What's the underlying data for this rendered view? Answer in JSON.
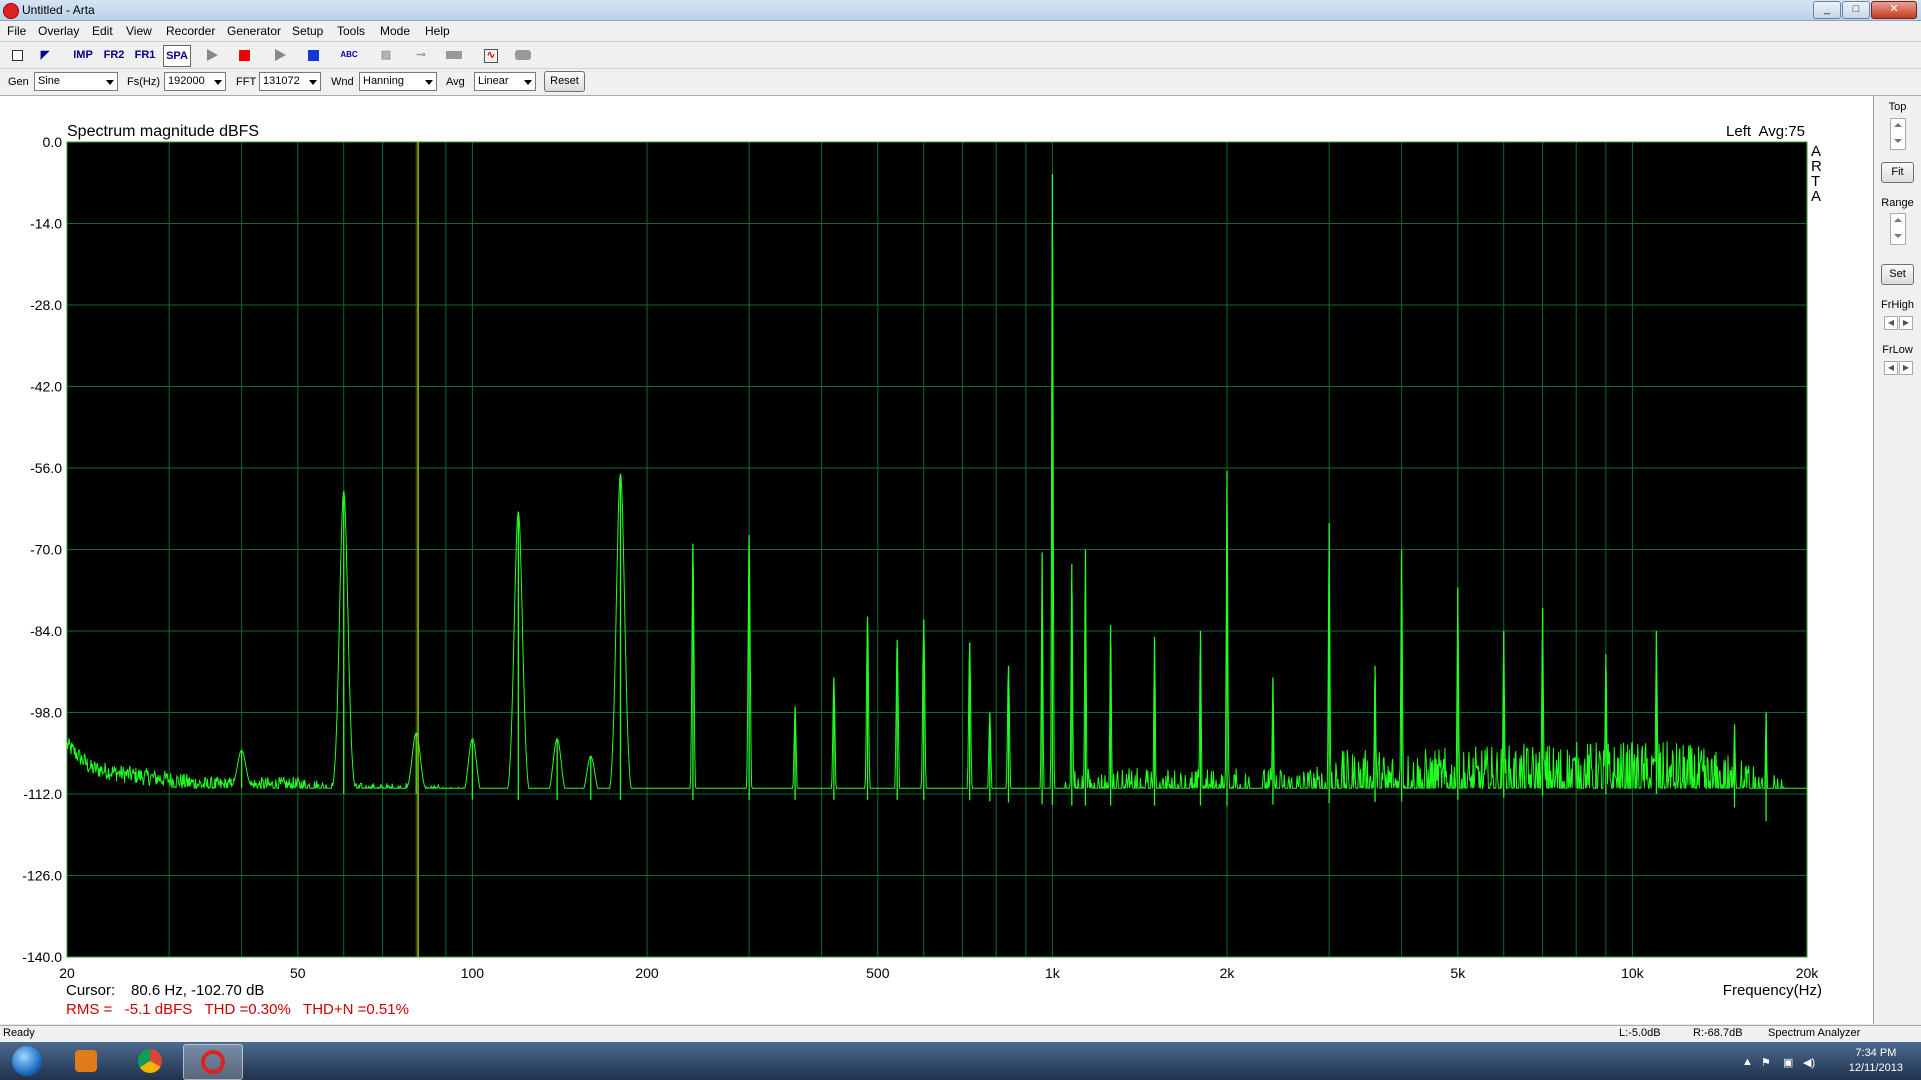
{
  "window": {
    "title": "Untitled - Arta",
    "min": "_",
    "max": "□",
    "close": "✕"
  },
  "menu": [
    "File",
    "Overlay",
    "Edit",
    "View",
    "Recorder",
    "Generator",
    "Setup",
    "Tools",
    "Mode",
    "Help"
  ],
  "toolbar": {
    "imp": "IMP",
    "fr2": "FR2",
    "fr1": "FR1",
    "spa": "SPA",
    "abc": "ABC"
  },
  "controls": {
    "gen_label": "Gen",
    "gen_value": "Sine",
    "fs_label": "Fs(Hz)",
    "fs_value": "192000",
    "fft_label": "FFT",
    "fft_value": "131072",
    "wnd_label": "Wnd",
    "wnd_value": "Hanning",
    "avg_label": "Avg",
    "avg_value": "Linear",
    "reset": "Reset"
  },
  "side": {
    "top": "Top",
    "fit": "Fit",
    "range": "Range",
    "set": "Set",
    "frhigh": "FrHigh",
    "frlow": "FrLow"
  },
  "plot": {
    "title": "Spectrum magnitude dBFS",
    "channel": "Left  Avg:75",
    "brand": [
      "A",
      "R",
      "T",
      "A"
    ],
    "cursor_label": "Cursor:",
    "cursor_value": "80.6 Hz, -102.70 dB",
    "rms": "RMS =   -5.1 dBFS   THD =0.30%   THD+N =0.51%",
    "xlabel": "Frequency(Hz)"
  },
  "chart_data": {
    "type": "line",
    "title": "Spectrum magnitude dBFS",
    "xlabel": "Frequency(Hz)",
    "ylabel": "",
    "x_scale": "log",
    "xlim": [
      20,
      20000
    ],
    "ylim": [
      -140,
      0
    ],
    "y_ticks": [
      "0.0",
      "-14.0",
      "-28.0",
      "-42.0",
      "-56.0",
      "-70.0",
      "-84.0",
      "-98.0",
      "-112.0",
      "-126.0",
      "-140.0"
    ],
    "y_tick_values": [
      0,
      -14,
      -28,
      -42,
      -56,
      -70,
      -84,
      -98,
      -112,
      -126,
      -140
    ],
    "x_ticks": [
      {
        "v": 20,
        "label": "20"
      },
      {
        "v": 50,
        "label": "50"
      },
      {
        "v": 100,
        "label": "100"
      },
      {
        "v": 200,
        "label": "200"
      },
      {
        "v": 500,
        "label": "500"
      },
      {
        "v": 1000,
        "label": "1k"
      },
      {
        "v": 2000,
        "label": "2k"
      },
      {
        "v": 5000,
        "label": "5k"
      },
      {
        "v": 10000,
        "label": "10k"
      },
      {
        "v": 20000,
        "label": "20k"
      }
    ],
    "cursor_x": 80.6,
    "grid": true,
    "noise_floor": [
      [
        20,
        -104
      ],
      [
        22,
        -108
      ],
      [
        25,
        -109
      ],
      [
        30,
        -110
      ],
      [
        35,
        -111
      ],
      [
        40,
        -111
      ],
      [
        50,
        -111
      ],
      [
        60,
        -112
      ],
      [
        80,
        -112
      ],
      [
        100,
        -113
      ],
      [
        200,
        -113
      ],
      [
        400,
        -113
      ],
      [
        700,
        -113
      ],
      [
        1050,
        -114
      ],
      [
        2000,
        -114
      ],
      [
        5000,
        -113
      ],
      [
        8000,
        -112
      ],
      [
        12000,
        -112
      ],
      [
        16000,
        -115
      ],
      [
        18500,
        -119
      ],
      [
        20000,
        -126
      ]
    ],
    "peaks": [
      {
        "f": 40,
        "db": -104.5
      },
      {
        "f": 60,
        "db": -60
      },
      {
        "f": 80,
        "db": -101.5
      },
      {
        "f": 100,
        "db": -102.5
      },
      {
        "f": 120,
        "db": -63.5
      },
      {
        "f": 140,
        "db": -102.5
      },
      {
        "f": 160,
        "db": -105.5
      },
      {
        "f": 180,
        "db": -57
      },
      {
        "f": 240,
        "db": -69
      },
      {
        "f": 300,
        "db": -67.5
      },
      {
        "f": 360,
        "db": -97
      },
      {
        "f": 420,
        "db": -92
      },
      {
        "f": 480,
        "db": -81.5
      },
      {
        "f": 540,
        "db": -85.5
      },
      {
        "f": 600,
        "db": -82
      },
      {
        "f": 720,
        "db": -86
      },
      {
        "f": 780,
        "db": -98
      },
      {
        "f": 840,
        "db": -90
      },
      {
        "f": 960,
        "db": -70.5
      },
      {
        "f": 1000,
        "db": -5.5
      },
      {
        "f": 1080,
        "db": -72.5
      },
      {
        "f": 1140,
        "db": -70
      },
      {
        "f": 1260,
        "db": -83
      },
      {
        "f": 1500,
        "db": -85
      },
      {
        "f": 1800,
        "db": -84
      },
      {
        "f": 2000,
        "db": -56.5
      },
      {
        "f": 2400,
        "db": -92
      },
      {
        "f": 3000,
        "db": -65.5
      },
      {
        "f": 3600,
        "db": -90
      },
      {
        "f": 4000,
        "db": -70
      },
      {
        "f": 5000,
        "db": -76.5
      },
      {
        "f": 6000,
        "db": -84
      },
      {
        "f": 7000,
        "db": -80
      },
      {
        "f": 9000,
        "db": -88
      },
      {
        "f": 11000,
        "db": -84
      },
      {
        "f": 15000,
        "db": -100
      },
      {
        "f": 17000,
        "db": -98
      }
    ]
  },
  "status": {
    "ready": "Ready",
    "l": "L:-5.0dB",
    "r": "R:-68.7dB",
    "mode": "Spectrum Analyzer"
  },
  "taskbar": {
    "time": "7:34 PM",
    "date": "12/11/2013"
  },
  "colors": {
    "plot_bg": "#000000",
    "grid": "#0d6e2a",
    "trace": "#22ff22",
    "cursor": "#b5b500",
    "readout_red": "#cc0000"
  }
}
